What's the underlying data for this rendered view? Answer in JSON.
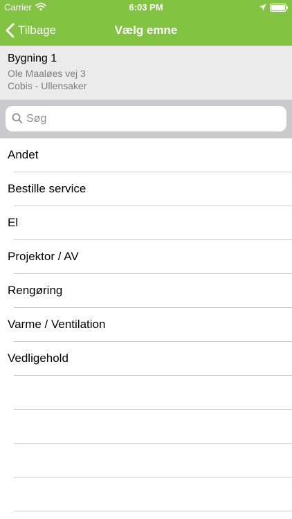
{
  "status_bar": {
    "carrier": "Carrier",
    "time": "6:03 PM",
    "icons": [
      "wifi-icon",
      "location-icon",
      "battery-icon"
    ]
  },
  "nav": {
    "back_label": "Tilbage",
    "title": "Vælg emne",
    "back_icon": "chevron-left-icon"
  },
  "building": {
    "name": "Bygning 1",
    "address": "Ole Maaløes vej 3",
    "company": "Cobis - Ullensaker"
  },
  "search": {
    "placeholder": "Søg",
    "value": ""
  },
  "topics": [
    {
      "label": "Andet"
    },
    {
      "label": "Bestille service"
    },
    {
      "label": "El"
    },
    {
      "label": "Projektor / AV"
    },
    {
      "label": "Rengøring"
    },
    {
      "label": "Varme / Ventilation"
    },
    {
      "label": "Vedligehold"
    }
  ],
  "colors": {
    "nav_background": "#82c341",
    "header_background": "#ebebeb",
    "search_bar_background": "#c9c9ce",
    "separator": "#c8c7cc",
    "secondary_text": "#7d7d7d"
  }
}
